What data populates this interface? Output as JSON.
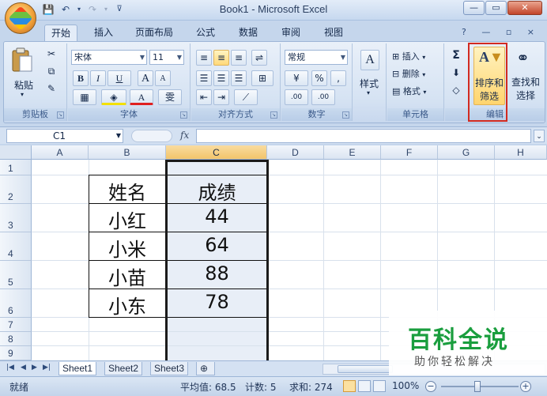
{
  "window": {
    "title": "Book1 - Microsoft Excel",
    "minimize_glyph": "—",
    "maximize_glyph": "▭",
    "close_glyph": "✕"
  },
  "qat": {
    "save_icon": "💾",
    "undo_icon": "↶",
    "undo_more_icon": "▾",
    "redo_icon": "↷",
    "redo_more_icon": "▾",
    "customize_icon": "⊽"
  },
  "tabs": [
    "开始",
    "插入",
    "页面布局",
    "公式",
    "数据",
    "审阅",
    "视图"
  ],
  "mdi_controls": "? — ▫ ×",
  "ribbon": {
    "clipboard": {
      "label": "剪贴板",
      "paste": "粘贴",
      "paste_arrow": "▾",
      "cut_icon": "✂",
      "copy_icon": "⧉",
      "format_painter_icon": "✎"
    },
    "font": {
      "label": "字体",
      "font_name": "宋体",
      "font_size": "11",
      "bold": "B",
      "italic": "I",
      "underline": "U",
      "grow": "A",
      "shrink": "A",
      "font_color_glyph": "A",
      "phonetic": "雯"
    },
    "alignment": {
      "label": "对齐方式"
    },
    "number": {
      "label": "数字",
      "format": "常规",
      "percent": "%",
      "comma": ",",
      "inc_decimal": ".00",
      "dec_decimal": ".00"
    },
    "styles": {
      "label": "样式"
    },
    "cells": {
      "label": "单元格",
      "insert": "插入",
      "delete": "删除",
      "format": "格式"
    },
    "editing": {
      "label": "编辑",
      "sum_icon": "Σ",
      "sort_filter_line1": "排序和",
      "sort_filter_line2": "筛选",
      "find_line1": "查找和",
      "find_line2": "选择"
    }
  },
  "formula_bar": {
    "name_box": "C1",
    "fx": "fx",
    "value": ""
  },
  "grid": {
    "columns": [
      "A",
      "B",
      "C",
      "D",
      "E",
      "F",
      "G",
      "H"
    ],
    "rows": [
      "1",
      "2",
      "3",
      "4",
      "5",
      "6",
      "7",
      "8",
      "9"
    ],
    "selected_column": "C",
    "table": {
      "headers": [
        "姓名",
        "成绩"
      ],
      "rows": [
        [
          "小红",
          "44"
        ],
        [
          "小米",
          "64"
        ],
        [
          "小苗",
          "88"
        ],
        [
          "小东",
          "78"
        ]
      ]
    }
  },
  "sheets": [
    "Sheet1",
    "Sheet2",
    "Sheet3"
  ],
  "status": {
    "ready": "就绪",
    "average": "平均值: 68.5",
    "count": "计数: 5",
    "sum": "求和: 274",
    "zoom": "100%"
  },
  "watermark": {
    "title": "百科全说",
    "subtitle": "助你轻松解决"
  }
}
